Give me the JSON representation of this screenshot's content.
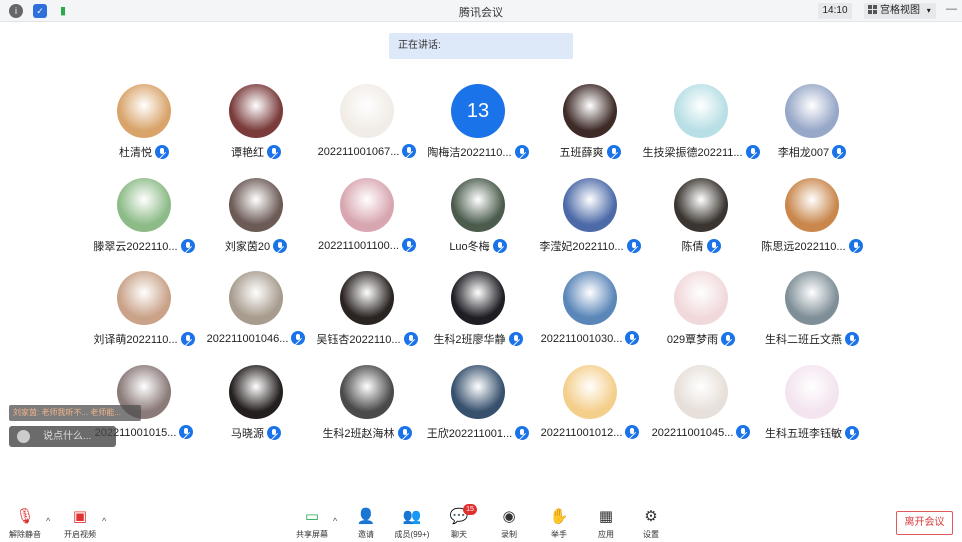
{
  "topbar": {
    "title": "腾讯会议",
    "time": "14:10",
    "view_label": "宫格视图",
    "view_caret": "▾"
  },
  "speaking_label": "正在讲话:",
  "participants": [
    {
      "name": "杜清悦",
      "avatar": "dog-photo-avatar",
      "color": "#d9a46a"
    },
    {
      "name": "谭艳红",
      "avatar": "person-photo-avatar",
      "color": "#7a3b3b"
    },
    {
      "name": "202211001067...",
      "avatar": "cartoon-avatar",
      "color": "#f1ece6"
    },
    {
      "name": "陶梅洁2022110...",
      "avatar_text": "13",
      "color": "#1a73e8"
    },
    {
      "name": "五班薛爽",
      "avatar": "person-photo-avatar",
      "color": "#3e2b28"
    },
    {
      "name": "生技梁振德202211...",
      "avatar": "cartoon-dog-avatar",
      "color": "#b7dfe5"
    },
    {
      "name": "李相龙007",
      "avatar": "photo-avatar",
      "color": "#97a7c7"
    },
    {
      "name": "滕翠云2022110...",
      "avatar": "bear-avatar",
      "color": "#8dbb87"
    },
    {
      "name": "刘家茵20",
      "avatar": "person-photo-avatar",
      "color": "#6b5a55"
    },
    {
      "name": "202211001100...",
      "avatar": "anime-avatar",
      "color": "#d8a6b0"
    },
    {
      "name": "Luo冬梅",
      "avatar": "photo-avatar",
      "color": "#4b5c4d"
    },
    {
      "name": "李滢妃2022110...",
      "avatar": "photo-avatar",
      "color": "#4c6aa8"
    },
    {
      "name": "陈倩",
      "avatar": "person-photo-avatar",
      "color": "#3a3530"
    },
    {
      "name": "陈思远2022110...",
      "avatar": "dog-photo-avatar",
      "color": "#c9874c"
    },
    {
      "name": "刘译萌2022110...",
      "avatar": "cat-photo-avatar",
      "color": "#c9a288"
    },
    {
      "name": "202211001046...",
      "avatar": "cat-photo-avatar",
      "color": "#a79c8e"
    },
    {
      "name": "吴钰杏2022110...",
      "avatar": "person-photo-avatar",
      "color": "#2a2422"
    },
    {
      "name": "生科2班廖华静",
      "avatar": "photo-avatar",
      "color": "#1e1e24"
    },
    {
      "name": "202211001030...",
      "avatar": "photo-avatar",
      "color": "#5a86b8"
    },
    {
      "name": "029覃梦雨",
      "avatar": "anime-avatar",
      "color": "#f1d9db"
    },
    {
      "name": "生科二班丘文燕",
      "avatar": "person-photo-avatar",
      "color": "#7f8f98"
    },
    {
      "name": "202211001015...",
      "avatar": "person-photo-avatar",
      "color": "#8a7a78"
    },
    {
      "name": "马晓源",
      "avatar": "person-photo-avatar",
      "color": "#241f1e"
    },
    {
      "name": "生科2班赵海林",
      "avatar": "photo-avatar",
      "color": "#4a4a4a"
    },
    {
      "name": "王欣202211001...",
      "avatar": "person-photo-avatar",
      "color": "#36506d"
    },
    {
      "name": "202211001012...",
      "avatar": "cartoon-avatar",
      "color": "#f4cf8c"
    },
    {
      "name": "202211001045...",
      "avatar": "person-photo-avatar",
      "color": "#e7dfd9"
    },
    {
      "name": "生科五班李钰敏",
      "avatar": "cartoon-avatar",
      "color": "#f3e4ef"
    }
  ],
  "chat": {
    "popup_text": "刘家茵: 老师我听不... 老师能...",
    "placeholder": "说点什么..."
  },
  "toolbar": {
    "unmute": "解除静音",
    "start_video": "开启视频",
    "share_screen": "共享屏幕",
    "invite": "邀请",
    "members": "成员(99+)",
    "chat": "聊天",
    "chat_badge": "15",
    "record": "录制",
    "raise_hand": "举手",
    "apps": "应用",
    "settings": "设置",
    "leave": "离开会议"
  },
  "colors": {
    "accent": "#1a73e8",
    "leave": "#d93a3a"
  }
}
